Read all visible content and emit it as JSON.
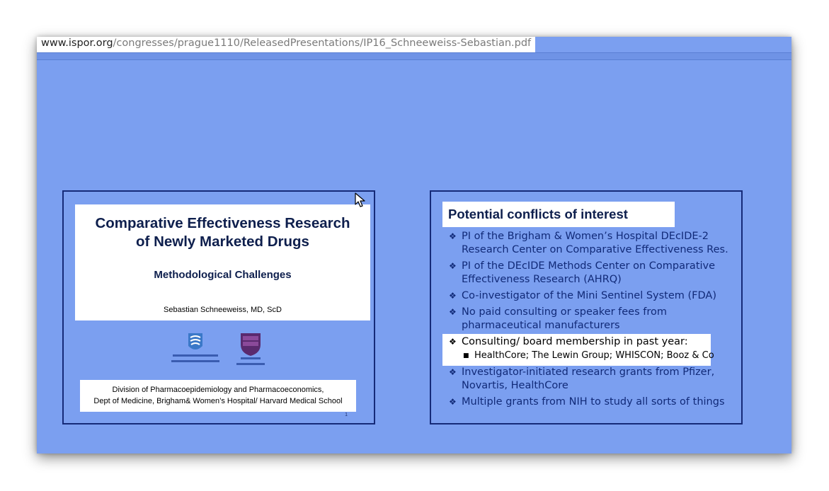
{
  "browser": {
    "url_domain": "www.ispor.org",
    "url_path": "/congresses/prague1110/ReleasedPresentations/IP16_Schneeweiss-Sebastian.pdf"
  },
  "slide1": {
    "title_line1": "Comparative Effectiveness Research",
    "title_line2": "of Newly Marketed Drugs",
    "subtitle": "Methodological Challenges",
    "author": "Sebastian Schneeweiss, MD, ScD",
    "logo_left_icon": "brigham-womens-hospital-logo",
    "logo_right_icon": "harvard-medical-school-shield-logo",
    "division_line1": "Division of Pharmacoepidemiology and Pharmacoeconomics,",
    "division_line2": "Dept of Medicine, Brigham& Women’s Hospital/ Harvard Medical School",
    "page_number": "1"
  },
  "slide2": {
    "title": "Potential conflicts of interest",
    "bullet_icon": "diamond-bullet-icon",
    "bullets": [
      "PI of the Brigham & Women’s Hospital DEcIDE-2 Research Center on Comparative Effectiveness Res.",
      "PI of the DEcIDE Methods Center on Comparative Effectiveness Research (AHRQ)",
      "Co-investigator of the Mini Sentinel System (FDA)",
      "No paid consulting or speaker fees from pharmaceutical manufacturers",
      "Consulting/ board membership in past year:",
      "Investigator-initiated research grants from Pfizer, Novartis, HealthCore",
      "Multiple grants from NIH to study all sorts of things"
    ],
    "subbullet": "HealthCore; The Lewin Group; WHISCON; Booz & Co"
  },
  "colors": {
    "background": "#7b9ff0",
    "slide_border": "#152a78",
    "text_navy": "#112a78"
  }
}
